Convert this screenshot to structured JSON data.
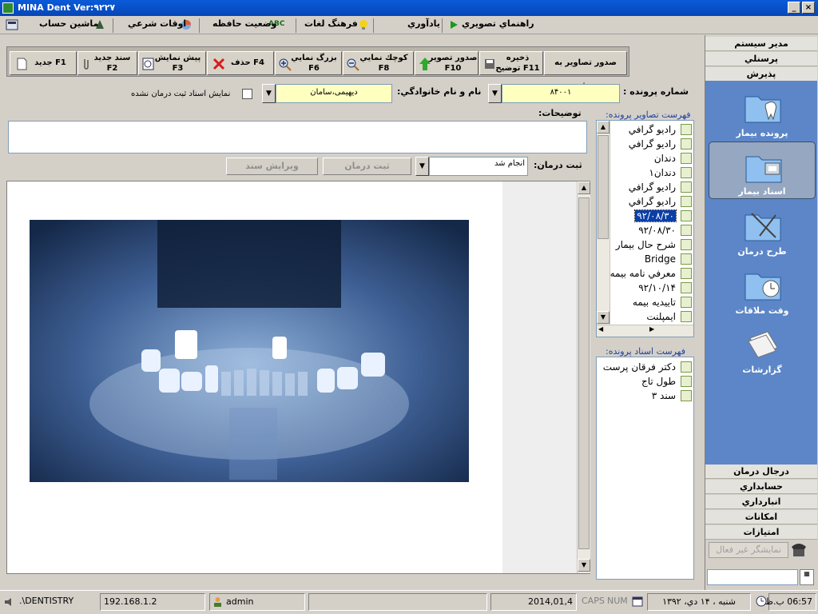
{
  "window": {
    "title": "MINA Dent Ver:۹۲۲۷",
    "min": "_",
    "max": "□",
    "close": "×"
  },
  "menubar": {
    "items": [
      "راهنماي تصويري",
      "يادآوري",
      "فرهنگ لغات",
      "وضعيت حافظه",
      "اوقات شرعي",
      "ماشين حساب"
    ]
  },
  "nav": {
    "top_sections": [
      "مدیر سیستم",
      "پرسنلي",
      "پذيرش"
    ],
    "items": [
      "پرونده بیمار",
      "اسناد بیمار",
      "طرح درمان",
      "وقت ملاقات",
      "گزارشات"
    ],
    "selected": "اسناد بیمار",
    "bottom_sections": [
      "درجال درمان",
      "حسابداري",
      "انبارداري",
      "امکانات",
      "امتیازات"
    ],
    "disabled_button": "نمایشگر غیر فعال"
  },
  "toolbar": {
    "buttons": [
      {
        "l1": "صدور تصاوير به بوشه",
        "l2": ""
      },
      {
        "l1": "ذخيره",
        "l2": "توضيح F11"
      },
      {
        "l1": "صدور تصوير",
        "l2": "F10"
      },
      {
        "l1": "كوچك نمايي",
        "l2": "F8"
      },
      {
        "l1": "بزرگ نمايي",
        "l2": "F6"
      },
      {
        "l1": "حذف F4",
        "l2": ""
      },
      {
        "l1": "پيش نمايش",
        "l2": "F3"
      },
      {
        "l1": "سند جديد",
        "l2": "F2"
      },
      {
        "l1": "جديد F1",
        "l2": ""
      }
    ]
  },
  "form": {
    "file_no_label": "شماره پرونده :",
    "file_no": "۸۴۰۰۱",
    "name_label": "نام و نام خانوادگي:",
    "name": "دیهیمی،سامان",
    "show_unreg_label": "نمايش اسناد ثبت درمان نشده",
    "desc_label": "توضيحات:",
    "treatment_label": "ثبت درمان:",
    "treatment_value": "انجام شد",
    "btn_register": "ثبت درمان",
    "btn_edit": "ويرايش سند"
  },
  "images_list": {
    "title": "فهرست تصاوير پرونده:",
    "items": [
      "راديو گرافي",
      "راديو گرافي",
      "دندان",
      "دندان۱",
      "راديو گرافي",
      "راديو گرافي",
      "۹۲/۰۸/۳۰",
      "۹۲/۰۸/۳۰",
      "شرح حال بيمار",
      "Bridge",
      "معرفي نامه بيمه",
      "۹۲/۱۰/۱۴",
      "تاييديه بيمه",
      "ايمپلنت"
    ],
    "selected_index": 6
  },
  "docs_list": {
    "title": "فهرست اسناد پرونده:",
    "items": [
      "دکتر فرقان پرست",
      "طول تاج",
      "سند ۳"
    ]
  },
  "status": {
    "path": ".\\DENTISTRY",
    "ip": "192.168.1.2",
    "user": "admin",
    "date_g": "2014,01,4",
    "caps": "CAPS",
    "num": "NUM",
    "date_p": "شنبه ، ۱۴ دي، ۱۳۹۲",
    "time": "06:57 ب.ظ"
  }
}
